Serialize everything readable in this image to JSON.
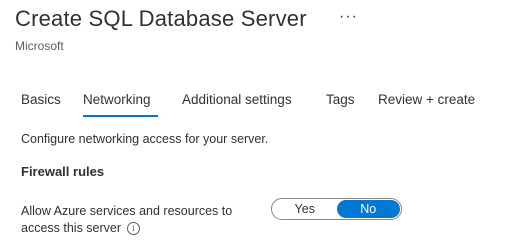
{
  "header": {
    "title": "Create SQL Database Server",
    "more_icon": "ellipsis-icon",
    "more_glyph": "···",
    "publisher": "Microsoft"
  },
  "tabs": [
    {
      "label": "Basics",
      "active": false
    },
    {
      "label": "Networking",
      "active": true
    },
    {
      "label": "Additional settings",
      "active": false
    },
    {
      "label": "Tags",
      "active": false
    },
    {
      "label": "Review + create",
      "active": false
    }
  ],
  "networking": {
    "description": "Configure networking access for your server.",
    "firewall_heading": "Firewall rules",
    "allow_azure": {
      "label_line1": "Allow Azure services and resources to",
      "label_line2": "access this server",
      "info_icon": "info-icon",
      "info_glyph": "i",
      "options": [
        "Yes",
        "No"
      ],
      "selected": "No"
    }
  },
  "colors": {
    "accent": "#0078d4",
    "text": "#323130",
    "secondary_text": "#605e5c"
  }
}
